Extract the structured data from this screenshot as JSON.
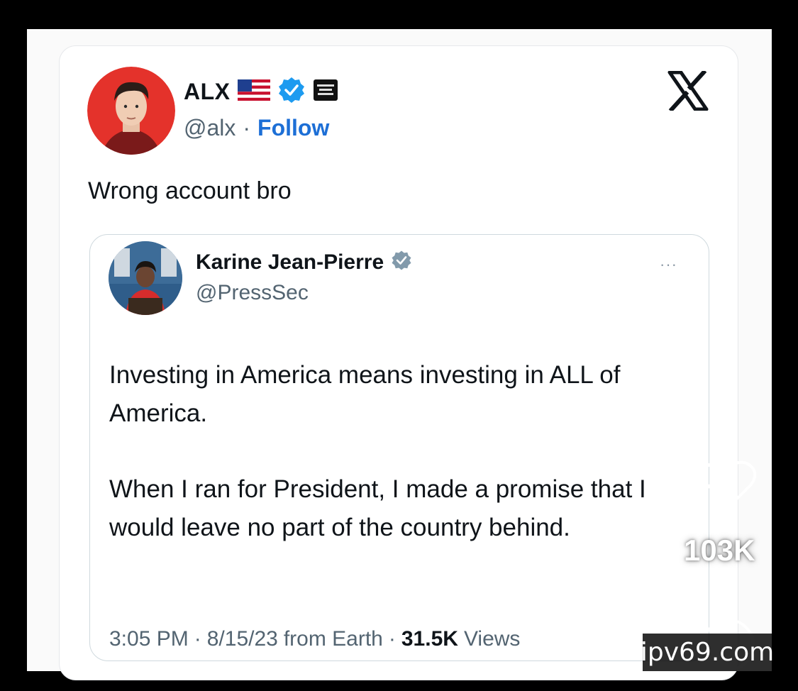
{
  "tweet": {
    "author_name": "ALX",
    "author_handle": "@alx",
    "separator": "·",
    "follow_label": "Follow",
    "text": "Wrong account bro",
    "icons": [
      "us-flag-icon",
      "verified-badge-icon",
      "affiliate-badge-icon",
      "x-logo-icon"
    ]
  },
  "quoted_tweet": {
    "author_name": "Karine Jean-Pierre",
    "author_handle": "@PressSec",
    "more_label": "···",
    "paragraph_1": "Investing in America means investing in ALL of America.",
    "paragraph_2": "When I ran for President, I made a promise that I would leave no part of the country behind.",
    "time": "3:05 PM",
    "date": "8/15/23",
    "source": "from Earth",
    "views_count": "31.5K",
    "views_label": "Views"
  },
  "overlay": {
    "like_count": "103K",
    "watermark": "ipv69.com"
  },
  "colors": {
    "follow_blue": "#1d6fd6",
    "verified_blue": "#1d9bf0",
    "gray_text": "#536471",
    "avatar_bg_red": "#e4322b"
  }
}
